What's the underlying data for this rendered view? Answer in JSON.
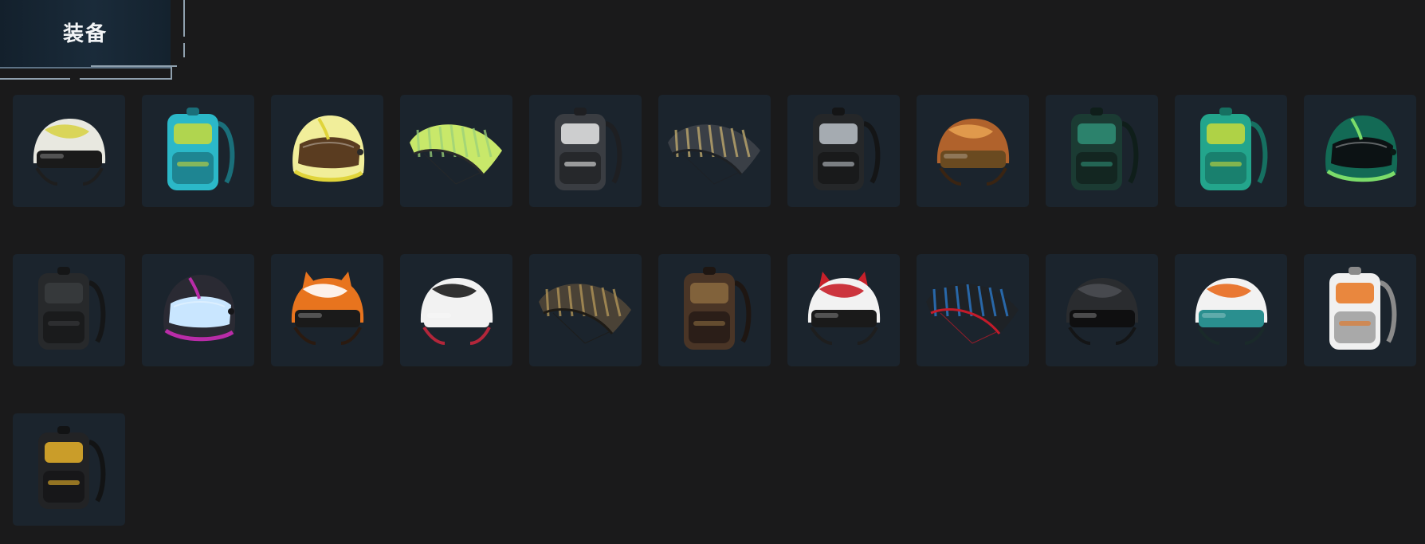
{
  "header": {
    "title": "装备"
  },
  "items": [
    {
      "kind": "helmet",
      "colors": [
        "#e8e8e0",
        "#d8d34a",
        "#1e1e1e"
      ],
      "visor": "#1a1a1a"
    },
    {
      "kind": "backpack",
      "colors": [
        "#2bb8c8",
        "#c8d93a",
        "#1a6f7a"
      ]
    },
    {
      "kind": "motohelmet",
      "colors": [
        "#f1ee9a",
        "#e0d43a",
        "#2a2a2a"
      ],
      "visor": "#5a3c20"
    },
    {
      "kind": "parachute",
      "colors": [
        "#c8e86a",
        "#9ad07a",
        "#2a2a2a"
      ]
    },
    {
      "kind": "backpack",
      "colors": [
        "#3a3d42",
        "#e8e8e8",
        "#1e1f22"
      ]
    },
    {
      "kind": "parachute",
      "colors": [
        "#3a3f46",
        "#c8b070",
        "#1e2125"
      ]
    },
    {
      "kind": "backpack",
      "colors": [
        "#252729",
        "#bcc3c9",
        "#141516"
      ]
    },
    {
      "kind": "helmet",
      "colors": [
        "#b0622c",
        "#e6a050",
        "#3a2412"
      ],
      "visor": "#6a4a20"
    },
    {
      "kind": "backpack",
      "colors": [
        "#1b3b33",
        "#2f8f77",
        "#0f1e1a"
      ]
    },
    {
      "kind": "backpack",
      "colors": [
        "#23a58c",
        "#c8d93a",
        "#167061"
      ]
    },
    {
      "kind": "motohelmet",
      "colors": [
        "#136a55",
        "#7bdc6a",
        "#0b1a16"
      ],
      "visor": "#0c1214"
    },
    {
      "kind": "backpack",
      "colors": [
        "#27292b",
        "#3a3c3e",
        "#151617"
      ]
    },
    {
      "kind": "motohelmet",
      "colors": [
        "#2a2a33",
        "#b92ca8",
        "#151518"
      ],
      "visor": "#c9e6ff"
    },
    {
      "kind": "helmet",
      "colors": [
        "#e8741e",
        "#ffffff",
        "#2a1a10"
      ],
      "visor": "#1a1a1a",
      "ears": "#e8741e"
    },
    {
      "kind": "helmet",
      "colors": [
        "#f2f2f2",
        "#1c1c1c",
        "#b3263a"
      ],
      "visor": "#f2f2f2"
    },
    {
      "kind": "parachute",
      "colors": [
        "#4a4236",
        "#b89a5a",
        "#1e1b16"
      ]
    },
    {
      "kind": "backpack",
      "colors": [
        "#4a3526",
        "#8b6a40",
        "#1e1612"
      ]
    },
    {
      "kind": "helmet",
      "colors": [
        "#f2f2f2",
        "#c8202a",
        "#1e1e1e"
      ],
      "visor": "#1a1a1a",
      "ears": "#c8202a"
    },
    {
      "kind": "parachute",
      "colors": [
        "#1e2226",
        "#2d7fd4",
        "#c31b2a"
      ]
    },
    {
      "kind": "helmet",
      "colors": [
        "#2a2c2f",
        "#4a4d52",
        "#141516"
      ],
      "visor": "#0f0f10"
    },
    {
      "kind": "helmet",
      "colors": [
        "#f2f2f2",
        "#e86a1e",
        "#1a2a2a"
      ],
      "visor": "#2a8f8f"
    },
    {
      "kind": "backpack",
      "colors": [
        "#f0f0f0",
        "#e8741e",
        "#8a8a8a"
      ]
    },
    {
      "kind": "backpack",
      "colors": [
        "#222325",
        "#e8b32a",
        "#121314"
      ]
    }
  ]
}
